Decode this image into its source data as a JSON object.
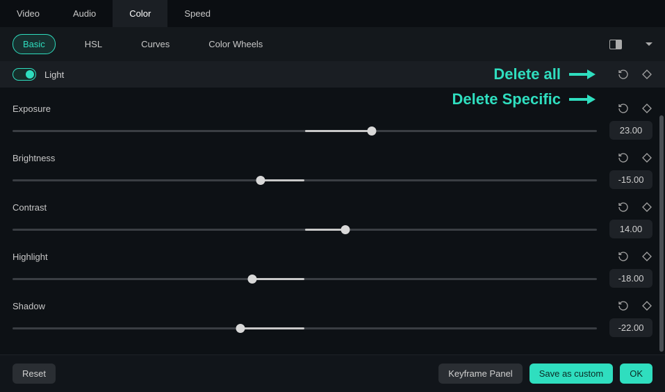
{
  "topTabs": [
    "Video",
    "Audio",
    "Color",
    "Speed"
  ],
  "topActive": 2,
  "subTabs": [
    "Basic",
    "HSL",
    "Curves",
    "Color Wheels"
  ],
  "subActive": 0,
  "lightToggleLabel": "Light",
  "annotations": {
    "deleteAll": "Delete all",
    "deleteSpecific": "Delete Specific"
  },
  "params": [
    {
      "label": "Exposure",
      "value": "23.00",
      "pct": 61.5
    },
    {
      "label": "Brightness",
      "value": "-15.00",
      "pct": 42.5
    },
    {
      "label": "Contrast",
      "value": "14.00",
      "pct": 57.0
    },
    {
      "label": "Highlight",
      "value": "-18.00",
      "pct": 41.0
    },
    {
      "label": "Shadow",
      "value": "-22.00",
      "pct": 39.0
    }
  ],
  "footer": {
    "reset": "Reset",
    "keyframe": "Keyframe Panel",
    "save": "Save as custom",
    "ok": "OK"
  }
}
